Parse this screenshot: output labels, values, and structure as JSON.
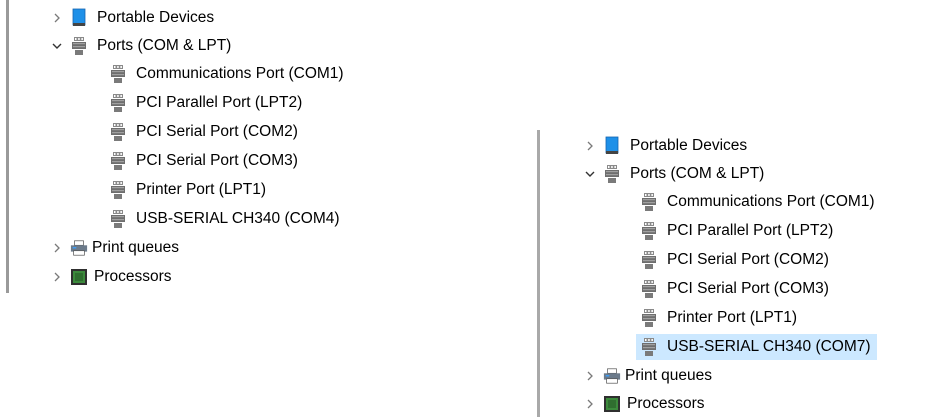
{
  "left_panel": {
    "portable_devices": {
      "label": "Portable Devices",
      "expanded": false
    },
    "ports": {
      "label": "Ports (COM & LPT)",
      "expanded": true
    },
    "port_items": [
      {
        "label": "Communications Port (COM1)"
      },
      {
        "label": "PCI Parallel Port (LPT2)"
      },
      {
        "label": "PCI Serial Port (COM2)"
      },
      {
        "label": "PCI Serial Port (COM3)"
      },
      {
        "label": "Printer Port (LPT1)"
      },
      {
        "label": "USB-SERIAL CH340 (COM4)"
      }
    ],
    "print_queues": {
      "label": "Print queues",
      "expanded": false
    },
    "processors": {
      "label": "Processors",
      "expanded": false
    }
  },
  "right_panel": {
    "portable_devices": {
      "label": "Portable Devices",
      "expanded": false
    },
    "ports": {
      "label": "Ports (COM & LPT)",
      "expanded": true
    },
    "port_items": [
      {
        "label": "Communications Port (COM1)"
      },
      {
        "label": "PCI Parallel Port (LPT2)"
      },
      {
        "label": "PCI Serial Port (COM2)"
      },
      {
        "label": "PCI Serial Port (COM3)"
      },
      {
        "label": "Printer Port (LPT1)"
      },
      {
        "label": "USB-SERIAL CH340 (COM7)",
        "selected": true
      }
    ],
    "print_queues": {
      "label": "Print queues",
      "expanded": false
    },
    "processors": {
      "label": "Processors",
      "expanded": false
    }
  },
  "colors": {
    "selection": "#cce8ff",
    "device_icon_blue": "#1e90e8",
    "port_icon_gray": "#6e6e6e",
    "processor_green": "#3c8a3c"
  },
  "icons": {
    "expand": "chevron-right-icon",
    "collapse": "chevron-down-icon",
    "portable_devices": "portable-device-icon",
    "port": "port-connector-icon",
    "print_queue": "printer-icon",
    "processor": "processor-chip-icon"
  }
}
